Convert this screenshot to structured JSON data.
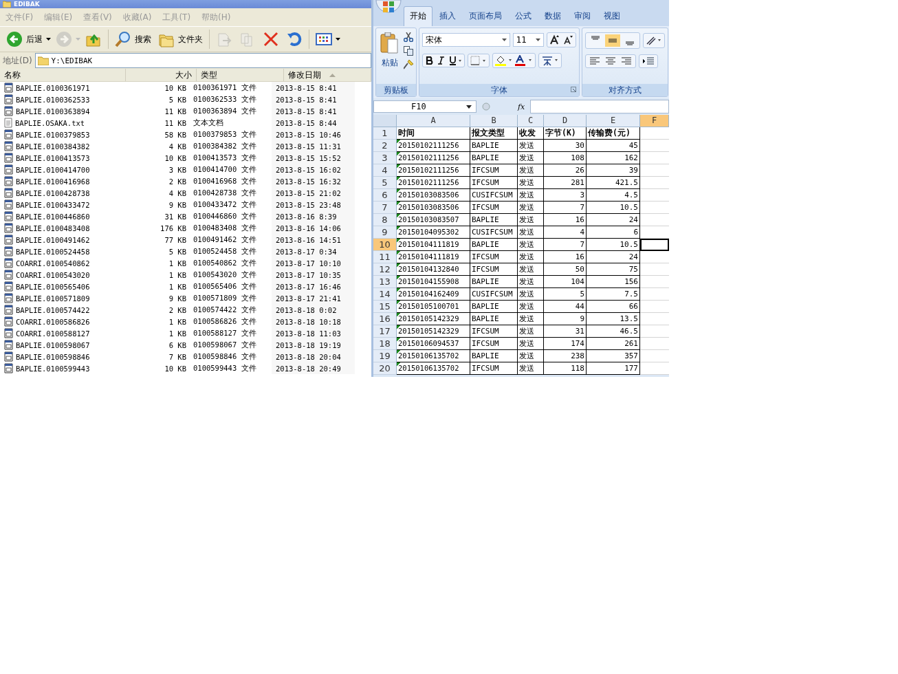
{
  "explorer": {
    "title": "EDIBAK",
    "menu": [
      "文件(F)",
      "编辑(E)",
      "查看(V)",
      "收藏(A)",
      "工具(T)",
      "帮助(H)"
    ],
    "toolbar": [
      {
        "kind": "back",
        "label": "后退",
        "disabled": false
      },
      {
        "kind": "forward",
        "disabled": true
      },
      {
        "kind": "up",
        "disabled": false
      },
      {
        "kind": "search",
        "label": "搜索",
        "disabled": false
      },
      {
        "kind": "folders",
        "label": "文件夹",
        "disabled": false
      },
      {
        "kind": "move",
        "disabled": true
      },
      {
        "kind": "copy",
        "disabled": true
      },
      {
        "kind": "delete",
        "disabled": false
      },
      {
        "kind": "undo",
        "disabled": false
      },
      {
        "kind": "views",
        "disabled": false
      }
    ],
    "address": {
      "label": "地址(D)",
      "value": "Y:\\EDIBAK"
    },
    "columns": [
      {
        "label": "名称",
        "sorted": false
      },
      {
        "label": "大小",
        "sorted": false
      },
      {
        "label": "类型",
        "sorted": false
      },
      {
        "label": "修改日期",
        "sorted": true
      }
    ],
    "files": [
      {
        "kind": "file",
        "name": "BAPLIE.0100361971",
        "size": "10 KB",
        "type": "0100361971 文件",
        "modified": "2013-8-15 8:41"
      },
      {
        "kind": "file",
        "name": "BAPLIE.0100362533",
        "size": "5 KB",
        "type": "0100362533 文件",
        "modified": "2013-8-15 8:41"
      },
      {
        "kind": "file",
        "name": "BAPLIE.0100363894",
        "size": "11 KB",
        "type": "0100363894 文件",
        "modified": "2013-8-15 8:41"
      },
      {
        "kind": "text",
        "name": "BAPLIE.OSAKA.txt",
        "size": "11 KB",
        "type": "文本文档",
        "modified": "2013-8-15 8:44"
      },
      {
        "kind": "file",
        "name": "BAPLIE.0100379853",
        "size": "58 KB",
        "type": "0100379853 文件",
        "modified": "2013-8-15 10:46"
      },
      {
        "kind": "file",
        "name": "BAPLIE.0100384382",
        "size": "4 KB",
        "type": "0100384382 文件",
        "modified": "2013-8-15 11:31"
      },
      {
        "kind": "file",
        "name": "BAPLIE.0100413573",
        "size": "10 KB",
        "type": "0100413573 文件",
        "modified": "2013-8-15 15:52"
      },
      {
        "kind": "file",
        "name": "BAPLIE.0100414700",
        "size": "3 KB",
        "type": "0100414700 文件",
        "modified": "2013-8-15 16:02"
      },
      {
        "kind": "file",
        "name": "BAPLIE.0100416968",
        "size": "2 KB",
        "type": "0100416968 文件",
        "modified": "2013-8-15 16:32"
      },
      {
        "kind": "file",
        "name": "BAPLIE.0100428738",
        "size": "4 KB",
        "type": "0100428738 文件",
        "modified": "2013-8-15 21:02"
      },
      {
        "kind": "file",
        "name": "BAPLIE.0100433472",
        "size": "9 KB",
        "type": "0100433472 文件",
        "modified": "2013-8-15 23:48"
      },
      {
        "kind": "file",
        "name": "BAPLIE.0100446860",
        "size": "31 KB",
        "type": "0100446860 文件",
        "modified": "2013-8-16 8:39"
      },
      {
        "kind": "file",
        "name": "BAPLIE.0100483408",
        "size": "176 KB",
        "type": "0100483408 文件",
        "modified": "2013-8-16 14:06"
      },
      {
        "kind": "file",
        "name": "BAPLIE.0100491462",
        "size": "77 KB",
        "type": "0100491462 文件",
        "modified": "2013-8-16 14:51"
      },
      {
        "kind": "file",
        "name": "BAPLIE.0100524458",
        "size": "5 KB",
        "type": "0100524458 文件",
        "modified": "2013-8-17 0:34"
      },
      {
        "kind": "file",
        "name": "COARRI.0100540862",
        "size": "1 KB",
        "type": "0100540862 文件",
        "modified": "2013-8-17 10:10"
      },
      {
        "kind": "file",
        "name": "COARRI.0100543020",
        "size": "1 KB",
        "type": "0100543020 文件",
        "modified": "2013-8-17 10:35"
      },
      {
        "kind": "file",
        "name": "BAPLIE.0100565406",
        "size": "1 KB",
        "type": "0100565406 文件",
        "modified": "2013-8-17 16:46"
      },
      {
        "kind": "file",
        "name": "BAPLIE.0100571809",
        "size": "9 KB",
        "type": "0100571809 文件",
        "modified": "2013-8-17 21:41"
      },
      {
        "kind": "file",
        "name": "BAPLIE.0100574422",
        "size": "2 KB",
        "type": "0100574422 文件",
        "modified": "2013-8-18 0:02"
      },
      {
        "kind": "file",
        "name": "COARRI.0100586826",
        "size": "1 KB",
        "type": "0100586826 文件",
        "modified": "2013-8-18 10:18"
      },
      {
        "kind": "file",
        "name": "COARRI.0100588127",
        "size": "1 KB",
        "type": "0100588127 文件",
        "modified": "2013-8-18 11:03"
      },
      {
        "kind": "file",
        "name": "BAPLIE.0100598067",
        "size": "6 KB",
        "type": "0100598067 文件",
        "modified": "2013-8-18 19:19"
      },
      {
        "kind": "file",
        "name": "BAPLIE.0100598846",
        "size": "7 KB",
        "type": "0100598846 文件",
        "modified": "2013-8-18 20:04"
      },
      {
        "kind": "file",
        "name": "BAPLIE.0100599443",
        "size": "10 KB",
        "type": "0100599443 文件",
        "modified": "2013-8-18 20:49"
      }
    ]
  },
  "excel": {
    "tabs": [
      {
        "label": "开始",
        "selected": true
      },
      {
        "label": "插入",
        "selected": false
      },
      {
        "label": "页面布局",
        "selected": false
      },
      {
        "label": "公式",
        "selected": false
      },
      {
        "label": "数据",
        "selected": false
      },
      {
        "label": "审阅",
        "selected": false
      },
      {
        "label": "视图",
        "selected": false
      }
    ],
    "clipboard": {
      "paste": "粘贴",
      "group": "剪贴板"
    },
    "font": {
      "name": "宋体",
      "size": "11",
      "group": "字体"
    },
    "alignment": {
      "group": "对齐方式",
      "vertical": [
        {
          "kind": "top",
          "selected": false
        },
        {
          "kind": "middle",
          "selected": true
        },
        {
          "kind": "bottom",
          "selected": false
        }
      ]
    },
    "name_box": "F10",
    "formula_label": "fx",
    "columns": [
      {
        "label": "A",
        "selected": false
      },
      {
        "label": "B",
        "selected": false
      },
      {
        "label": "C",
        "selected": false
      },
      {
        "label": "D",
        "selected": false
      },
      {
        "label": "E",
        "selected": false
      },
      {
        "label": "F",
        "selected": true
      }
    ],
    "rows": [
      {
        "number": "1",
        "selected": false,
        "kind": "header",
        "cells": [
          "时间",
          "报文类型",
          "收发",
          "字节(K)",
          "传输费(元)"
        ]
      },
      {
        "number": "2",
        "selected": false,
        "kind": "data",
        "cells": [
          "20150102111256",
          "BAPLIE",
          "发送",
          "30",
          "45"
        ]
      },
      {
        "number": "3",
        "selected": false,
        "kind": "data",
        "cells": [
          "20150102111256",
          "BAPLIE",
          "发送",
          "108",
          "162"
        ]
      },
      {
        "number": "4",
        "selected": false,
        "kind": "data",
        "cells": [
          "20150102111256",
          "IFCSUM",
          "发送",
          "26",
          "39"
        ]
      },
      {
        "number": "5",
        "selected": false,
        "kind": "data",
        "cells": [
          "20150102111256",
          "IFCSUM",
          "发送",
          "281",
          "421.5"
        ]
      },
      {
        "number": "6",
        "selected": false,
        "kind": "data",
        "cells": [
          "20150103083506",
          "CUSIFCSUM",
          "发送",
          "3",
          "4.5"
        ]
      },
      {
        "number": "7",
        "selected": false,
        "kind": "data",
        "cells": [
          "20150103083506",
          "IFCSUM",
          "发送",
          "7",
          "10.5"
        ]
      },
      {
        "number": "8",
        "selected": false,
        "kind": "data",
        "cells": [
          "20150103083507",
          "BAPLIE",
          "发送",
          "16",
          "24"
        ]
      },
      {
        "number": "9",
        "selected": false,
        "kind": "data",
        "cells": [
          "20150104095302",
          "CUSIFCSUM",
          "发送",
          "4",
          "6"
        ]
      },
      {
        "number": "10",
        "selected": true,
        "kind": "data",
        "cells": [
          "20150104111819",
          "BAPLIE",
          "发送",
          "7",
          "10.5"
        ]
      },
      {
        "number": "11",
        "selected": false,
        "kind": "data",
        "cells": [
          "20150104111819",
          "IFCSUM",
          "发送",
          "16",
          "24"
        ]
      },
      {
        "number": "12",
        "selected": false,
        "kind": "data",
        "cells": [
          "20150104132840",
          "IFCSUM",
          "发送",
          "50",
          "75"
        ]
      },
      {
        "number": "13",
        "selected": false,
        "kind": "data",
        "cells": [
          "20150104155908",
          "BAPLIE",
          "发送",
          "104",
          "156"
        ]
      },
      {
        "number": "14",
        "selected": false,
        "kind": "data",
        "cells": [
          "20150104162409",
          "CUSIFCSUM",
          "发送",
          "5",
          "7.5"
        ]
      },
      {
        "number": "15",
        "selected": false,
        "kind": "data",
        "cells": [
          "20150105100701",
          "BAPLIE",
          "发送",
          "44",
          "66"
        ]
      },
      {
        "number": "16",
        "selected": false,
        "kind": "data",
        "cells": [
          "20150105142329",
          "BAPLIE",
          "发送",
          "9",
          "13.5"
        ]
      },
      {
        "number": "17",
        "selected": false,
        "kind": "data",
        "cells": [
          "20150105142329",
          "IFCSUM",
          "发送",
          "31",
          "46.5"
        ]
      },
      {
        "number": "18",
        "selected": false,
        "kind": "data",
        "cells": [
          "20150106094537",
          "IFCSUM",
          "发送",
          "174",
          "261"
        ]
      },
      {
        "number": "19",
        "selected": false,
        "kind": "data",
        "cells": [
          "20150106135702",
          "BAPLIE",
          "发送",
          "238",
          "357"
        ]
      },
      {
        "number": "20",
        "selected": false,
        "kind": "data",
        "cells": [
          "20150106135702",
          "IFCSUM",
          "发送",
          "118",
          "177"
        ]
      }
    ]
  }
}
